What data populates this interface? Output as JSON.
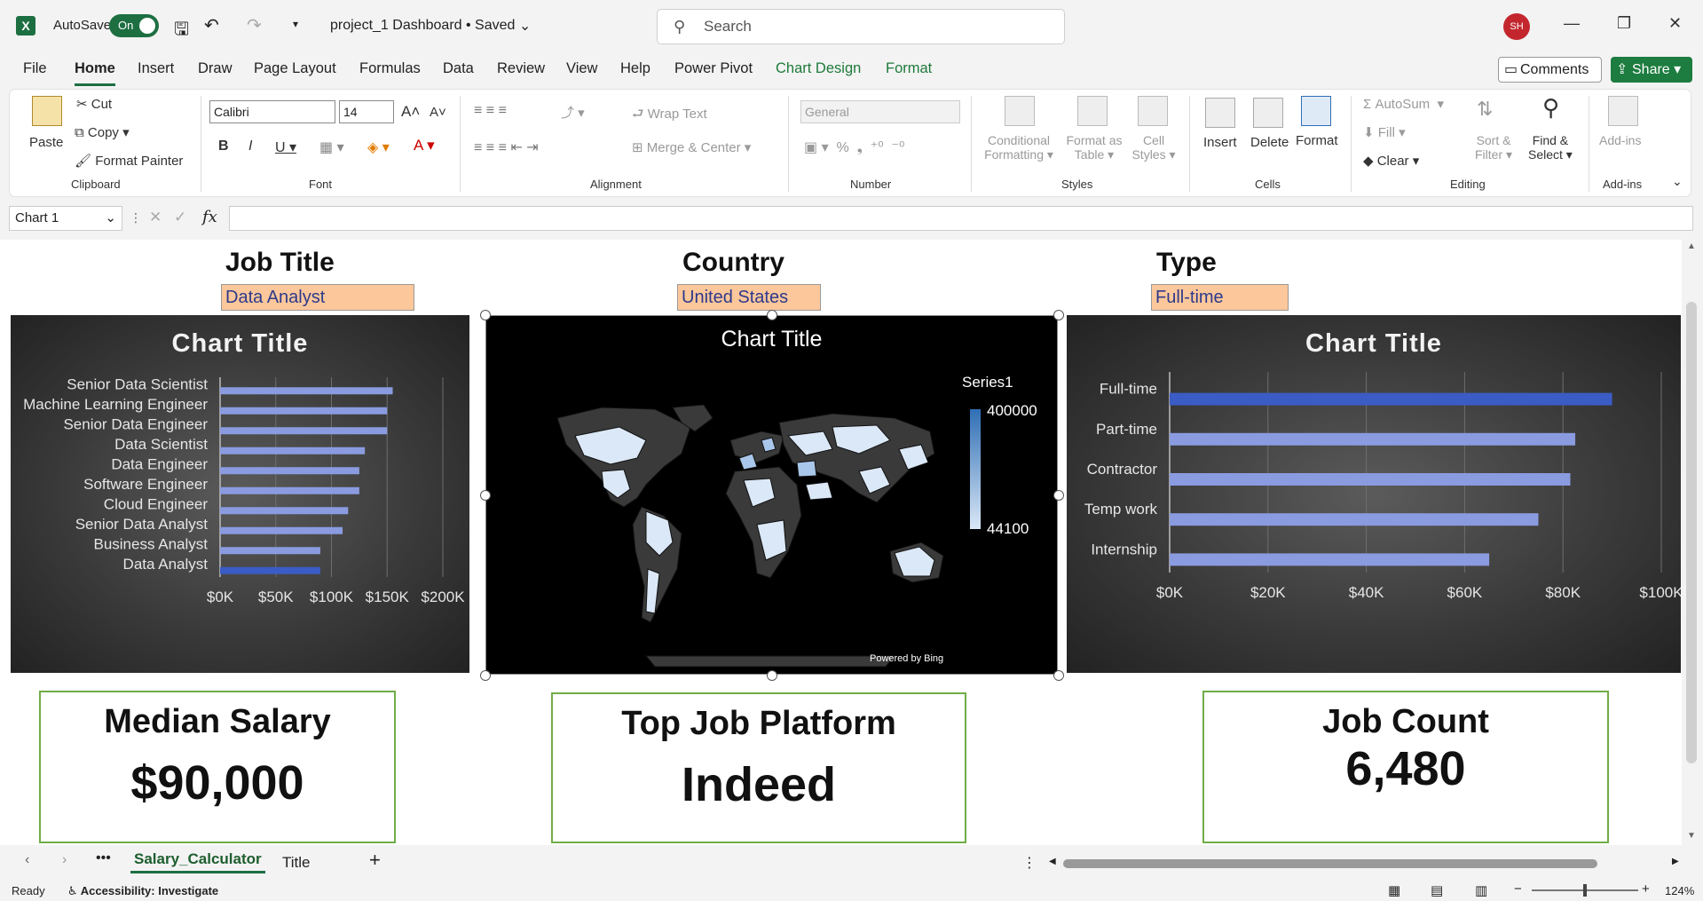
{
  "titlebar": {
    "autosave_label": "AutoSave",
    "autosave_state": "On",
    "doc_title": "project_1 Dashboard • Saved",
    "search_placeholder": "Search",
    "user_initials": "SH"
  },
  "menu": {
    "items": [
      "File",
      "Home",
      "Insert",
      "Draw",
      "Page Layout",
      "Formulas",
      "Data",
      "Review",
      "View",
      "Help",
      "Power Pivot",
      "Chart Design",
      "Format"
    ],
    "active": "Home",
    "comments_label": "Comments",
    "share_label": "Share"
  },
  "ribbon": {
    "clipboard": {
      "paste": "Paste",
      "cut": "Cut",
      "copy": "Copy",
      "format_painter": "Format Painter",
      "label": "Clipboard"
    },
    "font": {
      "family": "Calibri",
      "size": "14",
      "label": "Font"
    },
    "alignment": {
      "wrap_text": "Wrap Text",
      "merge_center": "Merge & Center",
      "label": "Alignment"
    },
    "number": {
      "format": "General",
      "label": "Number"
    },
    "styles": {
      "conditional": "Conditional",
      "conditional2": "Formatting",
      "format_as": "Format as",
      "format_as2": "Table",
      "cell": "Cell",
      "cell2": "Styles",
      "label": "Styles"
    },
    "cells": {
      "insert": "Insert",
      "delete": "Delete",
      "format": "Format",
      "label": "Cells"
    },
    "editing": {
      "autosum": "AutoSum",
      "fill": "Fill",
      "clear": "Clear",
      "sort": "Sort &",
      "sort2": "Filter",
      "find": "Find &",
      "find2": "Select",
      "label": "Editing"
    },
    "addins": {
      "addins": "Add-ins",
      "label": "Add-ins"
    }
  },
  "formula_bar": {
    "name_box": "Chart 1",
    "fx": "fx",
    "content": ""
  },
  "dashboard": {
    "headers": {
      "job_title": "Job Title",
      "country": "Country",
      "type": "Type"
    },
    "filters": {
      "job_title": "Data Analyst",
      "country": "United States",
      "type": "Full-time"
    },
    "kpi": {
      "median_label": "Median Salary",
      "median_value": "$90,000",
      "platform_label": "Top Job Platform",
      "platform_value": "Indeed",
      "count_label": "Job Count",
      "count_value": "6,480"
    }
  },
  "chart_data": [
    {
      "type": "bar",
      "title": "Chart Title",
      "categories": [
        "Senior Data Scientist",
        "Machine Learning Engineer",
        "Senior Data Engineer",
        "Data Scientist",
        "Data Engineer",
        "Software Engineer",
        "Cloud Engineer",
        "Senior Data Analyst",
        "Business Analyst",
        "Data Analyst"
      ],
      "values": [
        155000,
        150000,
        150000,
        130000,
        125000,
        125000,
        115000,
        110000,
        90000,
        90000
      ],
      "xticks": [
        "$0K",
        "$50K",
        "$100K",
        "$150K",
        "$200K"
      ],
      "xlim": [
        0,
        200000
      ],
      "highlight": "Data Analyst",
      "bar_color": "#8a9be0",
      "highlight_color": "#3b5cc4"
    },
    {
      "type": "map",
      "title": "Chart Title",
      "legend_title": "Series1",
      "legend_max": "400000",
      "legend_min": "44100",
      "attribution": "Powered by Bing",
      "color_low": "#dbe8f7",
      "color_high": "#2f6fb5"
    },
    {
      "type": "bar",
      "title": "Chart Title",
      "categories": [
        "Full-time",
        "Part-time",
        "Contractor",
        "Temp work",
        "Internship"
      ],
      "values": [
        90000,
        82500,
        81500,
        75000,
        65000
      ],
      "xticks": [
        "$0K",
        "$20K",
        "$40K",
        "$60K",
        "$80K",
        "$100K"
      ],
      "xlim": [
        0,
        100000
      ],
      "highlight": "Full-time",
      "bar_color": "#8a9be0",
      "highlight_color": "#3b5cc4"
    }
  ],
  "sheets": {
    "tabs": [
      "Salary_Calculator",
      "Title"
    ],
    "active": "Salary_Calculator"
  },
  "status": {
    "ready": "Ready",
    "accessibility": "Accessibility: Investigate",
    "zoom": "124%"
  }
}
